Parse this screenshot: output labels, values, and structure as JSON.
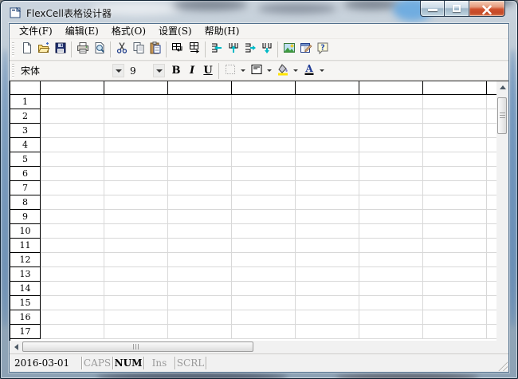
{
  "window": {
    "title": "FlexCell表格设计器",
    "caption_buttons": {
      "minimize": "minimize",
      "maximize": "maximize",
      "close": "close"
    }
  },
  "menu": {
    "items": [
      {
        "id": "file",
        "label": "文件(F)"
      },
      {
        "id": "edit",
        "label": "编辑(E)"
      },
      {
        "id": "format",
        "label": "格式(O)"
      },
      {
        "id": "settings",
        "label": "设置(S)"
      },
      {
        "id": "help",
        "label": "帮助(H)"
      }
    ]
  },
  "toolbar": {
    "icons": [
      "new-icon",
      "open-icon",
      "save-icon",
      "print-icon",
      "print-preview-icon",
      "cut-icon",
      "copy-icon",
      "paste-icon",
      "merge-cells-icon",
      "unmerge-cells-icon",
      "insert-row-icon",
      "insert-column-icon",
      "delete-row-icon",
      "delete-column-icon",
      "picture-icon",
      "properties-icon",
      "help-icon"
    ]
  },
  "format_toolbar": {
    "font_name": "宋体",
    "font_size": "9",
    "bold": "B",
    "italic": "I",
    "underline": "U",
    "icons": [
      "borders-icon",
      "alignment-icon",
      "fill-color-icon",
      "font-color-icon"
    ]
  },
  "grid": {
    "column_header_text": "",
    "column_count": 7,
    "partial_column": true,
    "row_labels": [
      "1",
      "2",
      "3",
      "4",
      "5",
      "6",
      "7",
      "8",
      "9",
      "10",
      "11",
      "12",
      "13",
      "14",
      "15",
      "16",
      "17"
    ]
  },
  "status_bar": {
    "date": "2016-03-01",
    "indicators": [
      {
        "label": "CAPS",
        "active": false
      },
      {
        "label": "NUM",
        "active": true
      },
      {
        "label": "Ins",
        "active": false
      },
      {
        "label": "SCRL",
        "active": false
      }
    ]
  },
  "colors": {
    "close_button_red": "#c44a28",
    "titlebar_glass": "#aebfcd",
    "header_border": "#000000",
    "grid_line": "#d8d8d8",
    "status_inactive_text": "#9b9b9b",
    "toolbar_arrow_cyan": "#00b9c6",
    "font_color_a": "#1f3a93"
  }
}
